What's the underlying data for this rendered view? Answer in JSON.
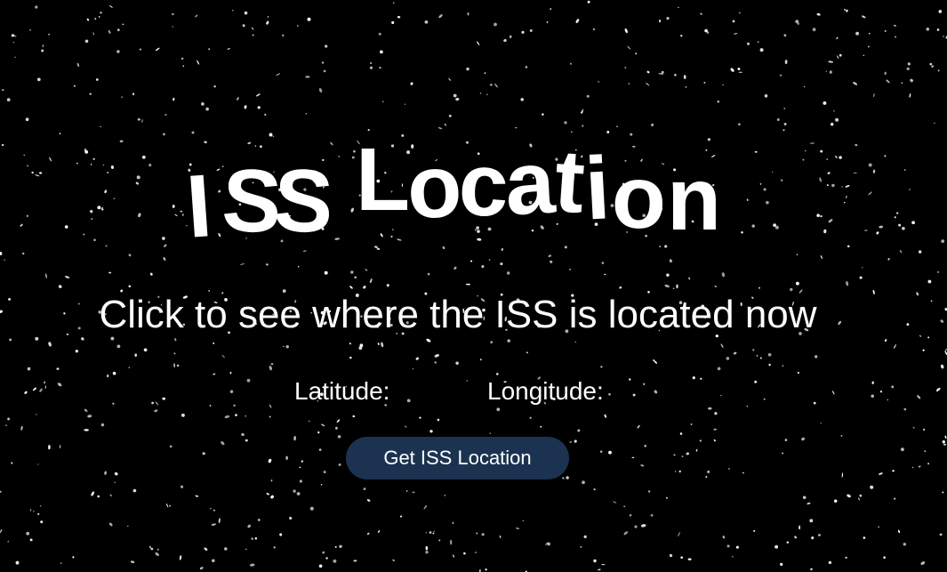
{
  "title": {
    "text": "ISS Location",
    "chars": [
      "I",
      "S",
      "S",
      "L",
      "o",
      "c",
      "a",
      "t",
      "i",
      "o",
      "n"
    ]
  },
  "subtitle": "Click to see where the ISS is located now",
  "coordinates": {
    "latitude_label": "Latitude:",
    "latitude_value": "",
    "longitude_label": "Longitude:",
    "longitude_value": ""
  },
  "button": {
    "label": "Get ISS Location"
  },
  "colors": {
    "background": "#000000",
    "text": "#ffffff",
    "button": "#1b3350"
  }
}
